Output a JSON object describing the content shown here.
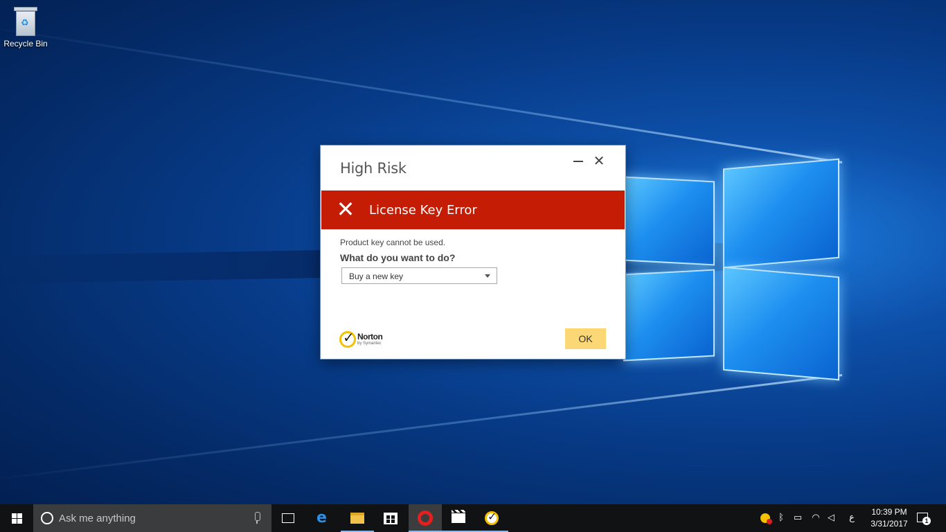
{
  "desktop": {
    "icons": [
      {
        "label": "Recycle Bin",
        "icon": "recycle-bin-icon"
      }
    ]
  },
  "dialog": {
    "title": "High Risk",
    "banner": "License Key Error",
    "message": "Product key cannot be used.",
    "question": "What do you want to do?",
    "action_select": {
      "selected": "Buy a new key"
    },
    "brand": {
      "name": "Norton",
      "sub": "by Symantec"
    },
    "ok_label": "OK",
    "colors": {
      "banner": "#c41c05",
      "ok_button": "#fbd775"
    }
  },
  "taskbar": {
    "search_placeholder": "Ask me anything",
    "apps": [
      {
        "name": "Task View",
        "icon": "task-view-icon"
      },
      {
        "name": "Microsoft Edge",
        "icon": "edge-icon"
      },
      {
        "name": "File Explorer",
        "icon": "file-explorer-icon"
      },
      {
        "name": "Store",
        "icon": "store-icon"
      },
      {
        "name": "Opera",
        "icon": "opera-icon"
      },
      {
        "name": "Movies & TV",
        "icon": "clapperboard-icon"
      },
      {
        "name": "Norton",
        "icon": "norton-icon"
      }
    ],
    "tray": {
      "keyboard_language": "ع",
      "time": "10:39 PM",
      "date": "3/31/2017",
      "notification_count": "1"
    }
  }
}
